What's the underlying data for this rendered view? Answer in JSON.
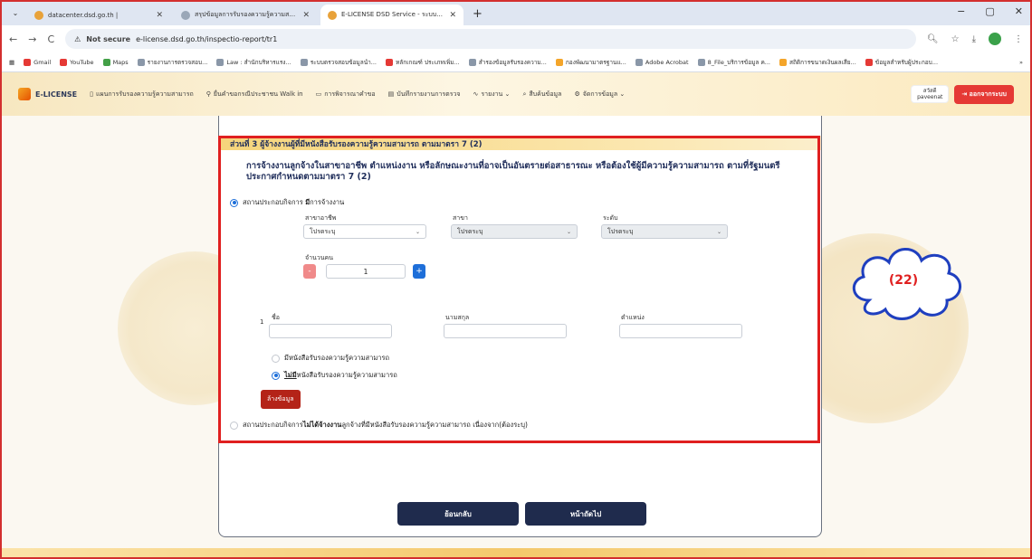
{
  "browser": {
    "tabs": [
      {
        "title": "datacenter.dsd.go.th |",
        "active": false
      },
      {
        "title": "สรุปข้อมูลการรับรองความรู้ความสามารถ",
        "active": false
      },
      {
        "title": "E-LICENSE DSD Service - ระบบ...",
        "active": true
      }
    ],
    "new_tab": "+",
    "window_controls": [
      "−",
      "▢",
      "✕"
    ],
    "security_label": "Not secure",
    "url": "e-license.dsd.go.th/inspectio-report/tr1",
    "bookmarks": [
      "Gmail",
      "YouTube",
      "Maps",
      "รายงานการตรวจสอบ...",
      "Law : สำนักบริหารแรง...",
      "ระบบตรวจสอบข้อมูลนำ...",
      "หลักเกณฑ์ ประเภทเพิ่ม...",
      "สำรองข้อมูลรับรองความ...",
      "กองพัฒนามาตรฐานแ...",
      "Adobe Acrobat",
      "8_File_บริการข้อมูล ค...",
      "สถิติการขนาดเงินผลเสีย...",
      "ข้อมูลสำหรับผู้ประกอบ..."
    ],
    "profile_initial": "●"
  },
  "app": {
    "logo": "E-LICENSE",
    "menu": [
      "แผนการรับรองความรู้ความสามารถ",
      "ยื่นคำขอกรณีประชาชน Walk in",
      "การพิจารณาคำขอ",
      "บันทึกรายงานการตรวจ",
      "รายงาน ⌄",
      "สืบค้นข้อมูล",
      "จัดการข้อมูล ⌄"
    ],
    "user_role": "สวัสดี",
    "user_name": "paveenat",
    "logout": "ออกจากระบบ"
  },
  "form": {
    "section_title": "ส่วนที่ 3 ผู้จ้างงานผู้ที่มีหนังสือรับรองความรู้ความสามารถ ตามมาตรา 7 (2)",
    "question": "การจ้างงานลูกจ้างในสาขาอาชีพ ตำแหน่งงาน หรือลักษณะงานที่อาจเป็นอันตรายต่อสาธารณะ หรือต้องใช้ผู้มีความรู้ความสามารถ ตามที่รัฐมนตรีประกาศกำหนดตามมาตรา 7 (2)",
    "option_employ_prefix": "สถานประกอบกิจการ ",
    "option_employ_bold": "มี",
    "option_employ_suffix": "การจ้างงาน",
    "career_label": "สาขาอาชีพ",
    "career_value": "โปรดระบุ",
    "branch_label": "สาขา",
    "branch_value": "โปรดระบุ",
    "level_label": "ระดับ",
    "level_value": "โปรดระบุ",
    "count_label": "จำนวนคน",
    "count_value": "1",
    "minus": "-",
    "plus": "+",
    "row_number": "1",
    "firstname_label": "ชื่อ",
    "lastname_label": "นามสกุล",
    "position_label": "ตำแหน่ง",
    "has_cert_label": "มีหนังสือรับรองความรู้ความสามารถ",
    "no_cert_bold": "ไม่มี",
    "no_cert_suffix": "หนังสือรับรองความรู้ความสามารถ",
    "clear_button": "ล้างข้อมูล",
    "option_no_employ_prefix": "สถานประกอบกิจการ",
    "option_no_employ_bold": "ไม่ได้จ้างงาน",
    "option_no_employ_suffix": "ลูกจ้างที่มีหนังสือรับรองความรู้ความสามารถ เนื่องจาก(ต้องระบุ)",
    "back_button": "ย้อนกลับ",
    "next_button": "หน้าถัดไป"
  },
  "annotation": {
    "label": "(22)",
    "color": "#e02020"
  }
}
